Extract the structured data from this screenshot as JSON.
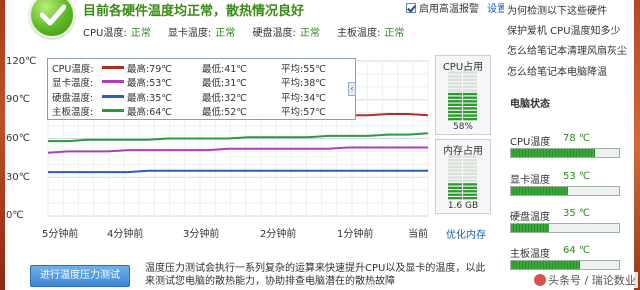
{
  "header": {
    "title": "目前各硬件温度均正常，散热情况良好",
    "statuses": [
      {
        "label": "CPU温度:",
        "value": "正常"
      },
      {
        "label": "显卡温度:",
        "value": "正常"
      },
      {
        "label": "硬盘温度:",
        "value": "正常"
      },
      {
        "label": "主板温度:",
        "value": "正常"
      }
    ],
    "alert_label": "启用高温报警",
    "alert_checked": true,
    "settings_link": "设置"
  },
  "faq_links": [
    "为何检测以下这些硬件",
    "保护爱机 CPU温度知多少",
    "怎么给笔记本清理风扇灰尘",
    "怎么给笔记本电脑降温"
  ],
  "pc_status": {
    "title": "电脑状态",
    "items": [
      {
        "label": "CPU温度",
        "value": "78 ℃",
        "level": 0.78
      },
      {
        "label": "显卡温度",
        "value": "53 ℃",
        "level": 0.53
      },
      {
        "label": "硬盘温度",
        "value": "35 ℃",
        "level": 0.35
      },
      {
        "label": "主板温度",
        "value": "64 ℃",
        "level": 0.64
      }
    ]
  },
  "meters": {
    "cpu": {
      "title": "CPU占用",
      "value": "58%",
      "level": 0.58
    },
    "memory": {
      "title": "内存占用",
      "value": "1.6 GB",
      "level": 0.42
    }
  },
  "optimize_link": "优化内存",
  "legend": [
    {
      "name": "CPU温度:",
      "max": "最高:79℃",
      "min": "最低:41℃",
      "avg": "平均:55℃",
      "color": "#b03020"
    },
    {
      "name": "显卡温度:",
      "max": "最高:53℃",
      "min": "最低:31℃",
      "avg": "平均:38℃",
      "color": "#b03cc0"
    },
    {
      "name": "硬盘温度:",
      "max": "最高:35℃",
      "min": "最低:32℃",
      "avg": "平均:34℃",
      "color": "#2a5fb8"
    },
    {
      "name": "主板温度:",
      "max": "最高:64℃",
      "min": "最低:52℃",
      "avg": "平均:57℃",
      "color": "#2a9a3a"
    }
  ],
  "chart_data": {
    "type": "line",
    "yticks": [
      "120℃",
      "90℃",
      "60℃",
      "30℃",
      "0℃"
    ],
    "xticks": [
      "5分钟前",
      "4分钟前",
      "3分钟前",
      "2分钟前",
      "1分钟前",
      "当前"
    ],
    "ylim": [
      0,
      120
    ],
    "grid": true,
    "series": [
      {
        "name": "CPU温度",
        "color": "#b03020",
        "values": [
          76,
          76,
          77,
          77,
          77,
          77,
          77,
          77,
          77,
          77,
          77,
          78,
          78,
          78,
          78,
          78,
          78,
          79,
          79,
          78
        ]
      },
      {
        "name": "显卡温度",
        "color": "#b03cc0",
        "values": [
          49,
          50,
          50,
          50,
          51,
          51,
          51,
          51,
          51,
          52,
          52,
          52,
          52,
          52,
          52,
          53,
          53,
          53,
          53,
          53
        ]
      },
      {
        "name": "硬盘温度",
        "color": "#2a5fb8",
        "values": [
          34,
          34,
          34,
          34,
          34,
          35,
          35,
          35,
          35,
          35,
          35,
          35,
          35,
          35,
          35,
          35,
          35,
          35,
          35,
          35
        ]
      },
      {
        "name": "主板温度",
        "color": "#2a9a3a",
        "values": [
          58,
          58,
          59,
          59,
          59,
          59,
          60,
          60,
          60,
          60,
          61,
          61,
          61,
          61,
          62,
          62,
          62,
          63,
          63,
          64
        ]
      }
    ]
  },
  "bottom": {
    "button_label": "进行温度压力测试",
    "description": "温度压力测试会执行一系列复杂的运算来快速提升CPU以及显卡的温度，以此来测试您电脑的散热能力，协助排查电脑潜在的散热故障"
  },
  "watermark": "头条号 / 瑞论数业"
}
